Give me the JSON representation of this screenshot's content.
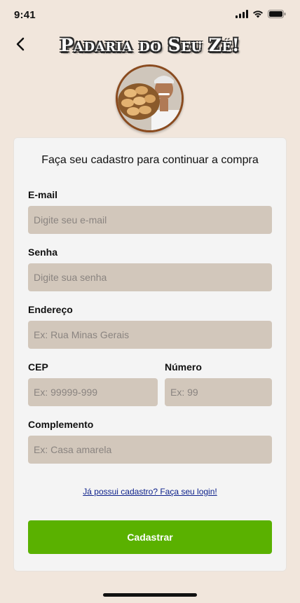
{
  "status_bar": {
    "time": "9:41",
    "icons": [
      "signal-icon",
      "wifi-icon",
      "battery-icon"
    ]
  },
  "header": {
    "back_icon": "chevron-left-icon",
    "title": "Padaria do Seu Zé!"
  },
  "logo": {
    "icon": "bakery-logo"
  },
  "form": {
    "title": "Faça seu cadastro para continuar a compra",
    "email": {
      "label": "E-mail",
      "placeholder": "Digite seu e-mail",
      "value": ""
    },
    "password": {
      "label": "Senha",
      "placeholder": "Digite sua senha",
      "value": ""
    },
    "address": {
      "label": "Endereço",
      "placeholder": "Ex: Rua Minas Gerais",
      "value": ""
    },
    "cep": {
      "label": "CEP",
      "placeholder": "Ex: 99999-999",
      "value": ""
    },
    "number": {
      "label": "Número",
      "placeholder": "Ex: 99",
      "value": ""
    },
    "complement": {
      "label": "Complemento",
      "placeholder": "Ex: Casa amarela",
      "value": ""
    },
    "login_link": "Já possui cadastro? Faça seu login!",
    "submit_label": "Cadastrar"
  },
  "colors": {
    "background": "#f1e6dc",
    "input_bg": "#d2c7bb",
    "accent": "#5ab100",
    "link": "#0b1f8a"
  }
}
